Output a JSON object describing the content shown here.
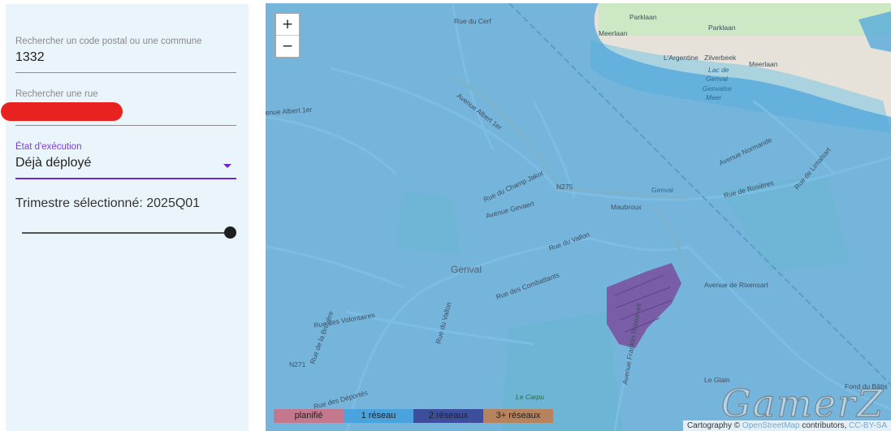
{
  "sidebar": {
    "postal_search": {
      "label": "Rechercher un code postal ou une commune",
      "value": "1332"
    },
    "street_search": {
      "label": "Rechercher une rue",
      "value": ""
    },
    "status_select": {
      "label": "État d'exécution",
      "value": "Déjà déployé"
    },
    "quarter_text": "Trimestre sélectionné: 2025Q01",
    "quarter_slider": {
      "position_fraction": 1.0
    }
  },
  "map": {
    "zoom_in": "+",
    "zoom_out": "−",
    "overlay_color": "#4aa3dc",
    "deployed_area_color": "#7a4d9c",
    "labels": {
      "parklaan_1": "Parklaan",
      "parklaan_2": "Parklaan",
      "meerlaan_1": "Meerlaan",
      "meerlaan_2": "Meerlaan",
      "argentine": "L'Argentine",
      "zilverbeek": "Zilverbeek",
      "lac_genval_1": "Lac de",
      "lac_genval_2": "Genval",
      "genvalmeer_1": "Genvalse",
      "genvalmeer_2": "Meer",
      "rue_du_cerf": "Rue du Cerf",
      "avenue_albert_1": "Avenue Albert 1er",
      "avenue_albert_2": "Avenue Albert 1er",
      "n275": "N275",
      "genval_station": "Genval",
      "maubroux": "Maubroux",
      "rue_champ": "Rue du Champ Jakot",
      "rue_du_vallon_1": "Rue du Vallon",
      "rue_du_vallon_2": "Rue du Vallon",
      "genval": "Genval",
      "avenue_gevaert": "Avenue Gevaert",
      "rue_bruyere": "Rue de la Bruyère",
      "n271": "N271",
      "rue_deportes": "Rue des Déportés",
      "le_carpu": "Le Carpu",
      "le_glain": "Le Glain",
      "fond_batis": "Fond du Bâtis",
      "rue_rosieres": "Rue de Rosières",
      "avenue_rixensart": "Avenue de Rixensart",
      "avenue_franklin": "Avenue Franklin Roosevelt",
      "rue_des_volontaires": "Rue des Volontaires",
      "rue_des_combattants": "Rue des Combattants",
      "avenue_normande": "Avenue Normande",
      "rue_de_limalsart": "Rue de Limalsart"
    },
    "legend": [
      {
        "label": "planifié",
        "color": "#c4788e"
      },
      {
        "label": "1 réseau",
        "color": "#4aa3dc"
      },
      {
        "label": "2 réseaux",
        "color": "#3d4f9c"
      },
      {
        "label": "3+ réseaux",
        "color": "#b7825e"
      }
    ],
    "attribution": {
      "prefix": "Cartography ©",
      "link": "OpenStreetMap",
      "suffix": "contributors,",
      "license": "CC-BY-SA"
    },
    "watermark": "GamerZ"
  }
}
